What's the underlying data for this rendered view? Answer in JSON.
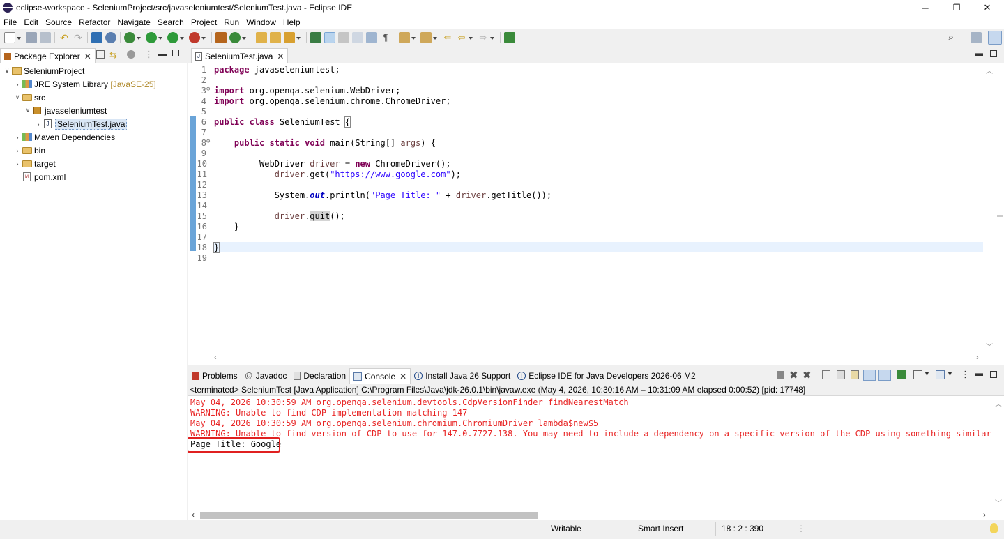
{
  "window": {
    "title": "eclipse-workspace - SeleniumProject/src/javaseleniumtest/SeleniumTest.java - Eclipse IDE",
    "minimize": "─",
    "maximize": "❐",
    "close": "✕"
  },
  "menu": [
    "File",
    "Edit",
    "Source",
    "Refactor",
    "Navigate",
    "Search",
    "Project",
    "Run",
    "Window",
    "Help"
  ],
  "package_explorer": {
    "tab_label": "Package Explorer",
    "tree": {
      "project": "SeleniumProject",
      "jre": "JRE System Library",
      "jre_version": "[JavaSE-25]",
      "src": "src",
      "package": "javaseleniumtest",
      "file": "SeleniumTest.java",
      "maven": "Maven Dependencies",
      "bin": "bin",
      "target": "target",
      "pom": "pom.xml"
    }
  },
  "editor": {
    "tab_label": "SeleniumTest.java",
    "line_numbers": [
      "1",
      "2",
      "3",
      "4",
      "5",
      "6",
      "7",
      "8",
      "9",
      "10",
      "11",
      "12",
      "13",
      "14",
      "15",
      "16",
      "17",
      "18",
      "19"
    ],
    "code": {
      "l1_kw": "package",
      "l1_rest": " javaseleniumtest;",
      "l3_kw": "import",
      "l3_rest": " org.openqa.selenium.WebDriver;",
      "l4_kw": "import",
      "l4_rest": " org.openqa.selenium.chrome.ChromeDriver;",
      "l6_kw1": "public",
      "l6_kw2": "class",
      "l6_name": " SeleniumTest ",
      "l6_brace": "{",
      "l8_kw1": "public",
      "l8_kw2": "static",
      "l8_kw3": "void",
      "l8_a": " main(String[] ",
      "l8_var": "args",
      "l8_b": ") {",
      "l10_a": "WebDriver ",
      "l10_var": "driver",
      "l10_b": " = ",
      "l10_kw": "new",
      "l10_c": " ChromeDriver();",
      "l11_var": "driver",
      "l11_a": ".get(",
      "l11_str": "\"https://www.google.com\"",
      "l11_b": ");",
      "l13_a": "System.",
      "l13_fld": "out",
      "l13_b": ".println(",
      "l13_str": "\"Page Title: \"",
      "l13_c": " + ",
      "l13_var": "driver",
      "l13_d": ".getTitle());",
      "l15_var": "driver",
      "l15_a": ".",
      "l15_hl": "quit",
      "l15_b": "();",
      "l16": "}",
      "l18": "}"
    }
  },
  "bottom_tabs": {
    "problems": "Problems",
    "javadoc": "Javadoc",
    "declaration": "Declaration",
    "console": "Console",
    "install": "Install Java 26 Support",
    "eclipse_ide": "Eclipse IDE for Java Developers 2026-06 M2"
  },
  "console": {
    "header": "<terminated> SeleniumTest [Java Application] C:\\Program Files\\Java\\jdk-26.0.1\\bin\\javaw.exe  (May 4, 2026, 10:30:16 AM – 10:31:09 AM elapsed 0:00:52) [pid: 17748]",
    "lines": [
      "May 04, 2026 10:30:59 AM org.openqa.selenium.devtools.CdpVersionFinder findNearestMatch",
      "WARNING: Unable to find CDP implementation matching 147",
      "May 04, 2026 10:30:59 AM org.openqa.selenium.chromium.ChromiumDriver lambda$new$5",
      "WARNING: Unable to find version of CDP to use for 147.0.7727.138. You may need to include a dependency on a specific version of the CDP using something similar to `org.se"
    ],
    "output": "Page Title: Google",
    "highlight_color": "#e02020"
  },
  "status": {
    "writable": "Writable",
    "insert": "Smart Insert",
    "position": "18 : 2 : 390"
  }
}
